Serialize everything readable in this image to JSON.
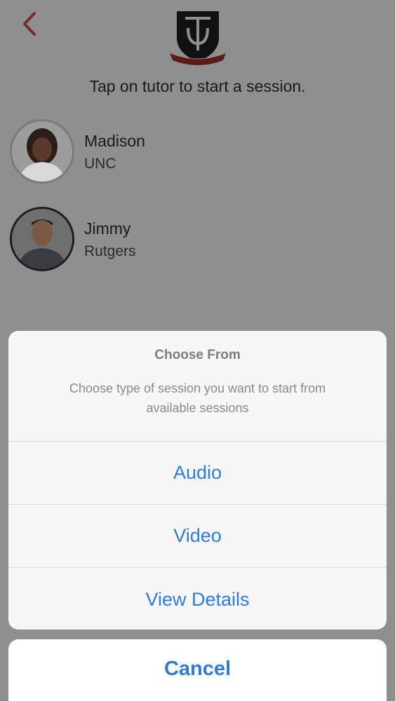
{
  "header": {
    "back_icon": "chevron-left-icon",
    "logo_icon": "shield-monogram-icon",
    "accent_color": "#c0392b"
  },
  "instruction": "Tap on tutor to start a session.",
  "tutors": [
    {
      "name": "Madison",
      "school": "UNC"
    },
    {
      "name": "Jimmy",
      "school": "Rutgers"
    }
  ],
  "action_sheet": {
    "title": "Choose From",
    "message": "Choose type of session you want to start from available sessions",
    "actions": [
      {
        "label": "Audio"
      },
      {
        "label": "Video"
      },
      {
        "label": "View Details"
      }
    ],
    "cancel_label": "Cancel",
    "action_color": "#2f7bdd"
  }
}
